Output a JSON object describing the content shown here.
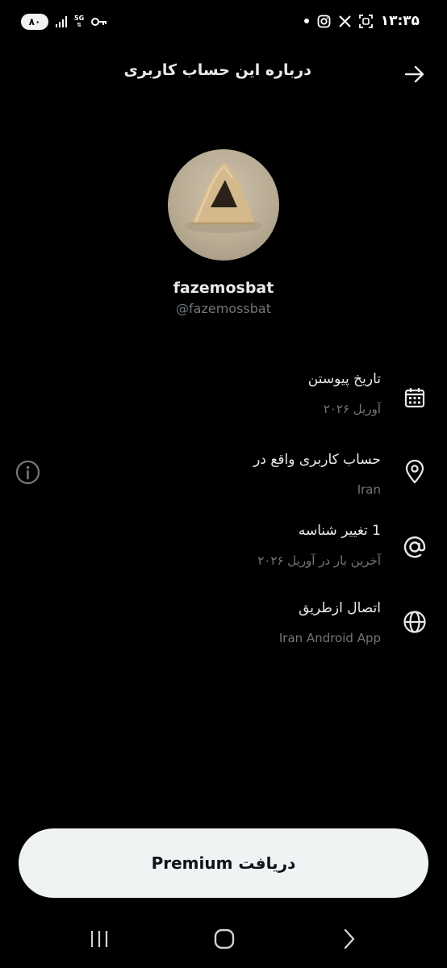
{
  "status_bar": {
    "battery": "۸۰",
    "network": "5G",
    "time": "۱۳:۳۵",
    "icons": [
      "signal-icon",
      "network-5g-icon",
      "key-icon",
      "dot-icon",
      "instagram-icon",
      "x-icon",
      "screenshot-icon"
    ]
  },
  "header": {
    "title": "درباره این حساب کاربری",
    "back_icon": "arrow-right-icon"
  },
  "profile": {
    "display_name": "fazemosbat",
    "handle": "@fazemossbat"
  },
  "info": [
    {
      "icon": "calendar-icon",
      "title": "تاریخ پیوستن",
      "subtitle": "آوریل ۲۰۲۶"
    },
    {
      "icon": "location-icon",
      "title": "حساب کاربری واقع در",
      "subtitle": "Iran"
    },
    {
      "icon": "at-icon",
      "title": "1 تغییر شناسه",
      "subtitle": "آخرین بار در آوریل ۲۰۲۶"
    },
    {
      "icon": "globe-icon",
      "title": "اتصال ازطریق",
      "subtitle": "Iran Android App"
    }
  ],
  "info_button_icon": "info-circle-icon",
  "premium_button": {
    "label": "دریافت Premium"
  },
  "nav_bar": [
    "recent-apps-icon",
    "home-icon",
    "back-icon"
  ],
  "colors": {
    "background": "#000000",
    "primary_text": "#e7e9ea",
    "secondary_text": "#71767b",
    "button_bg": "#eff3f4",
    "button_text": "#0f1419"
  }
}
